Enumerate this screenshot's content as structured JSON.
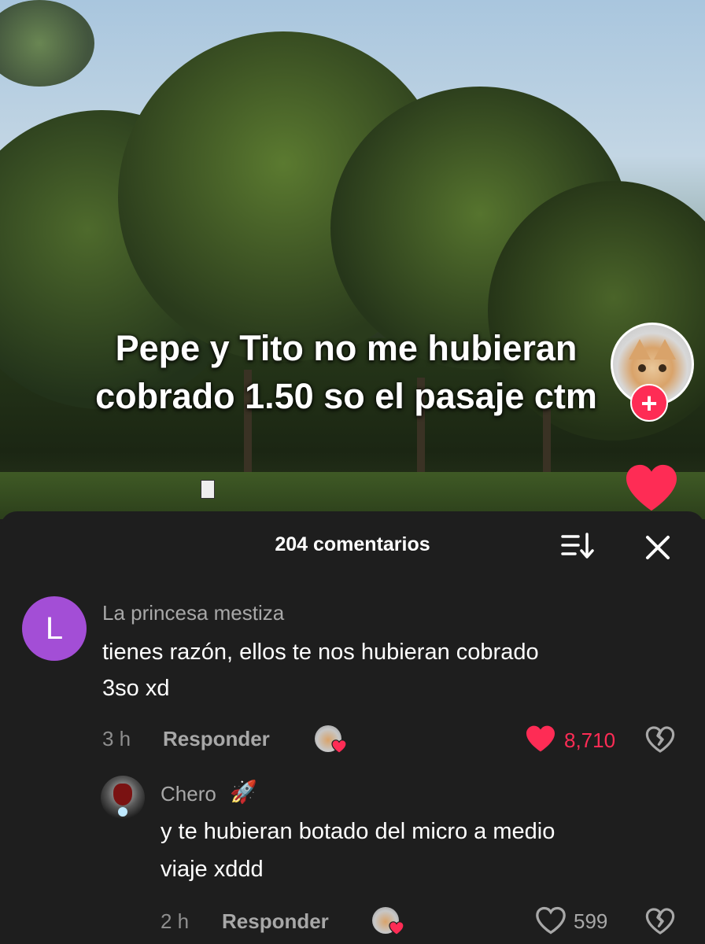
{
  "video": {
    "caption": "Pepe y Tito no me hubieran cobrado 1.50 so el pasaje ctm",
    "follow_label": "+"
  },
  "comments_sheet": {
    "title": "204 comentarios",
    "comments": [
      {
        "avatar_letter": "L",
        "username": "La princesa mestiza",
        "text_line1": "tienes razón, ellos te nos hubieran cobrado",
        "text_line2": "3so xd",
        "time": "3 h",
        "reply_label": "Responder",
        "likes": "8,710",
        "liked": true
      },
      {
        "username": "Chero",
        "username_emoji": "🚀",
        "text_line1": "y te hubieran botado del micro a medio",
        "text_line2": "viaje xddd",
        "time": "2 h",
        "reply_label": "Responder",
        "likes": "599",
        "liked": false
      }
    ]
  },
  "colors": {
    "accent": "#fe2c55",
    "sheet_bg": "#1e1e1e",
    "avatar_purple": "#a34ed6"
  },
  "icons": [
    "follow-plus-icon",
    "like-heart-icon",
    "sort-icon",
    "close-icon",
    "dislike-icon",
    "creator-heart-icon"
  ]
}
